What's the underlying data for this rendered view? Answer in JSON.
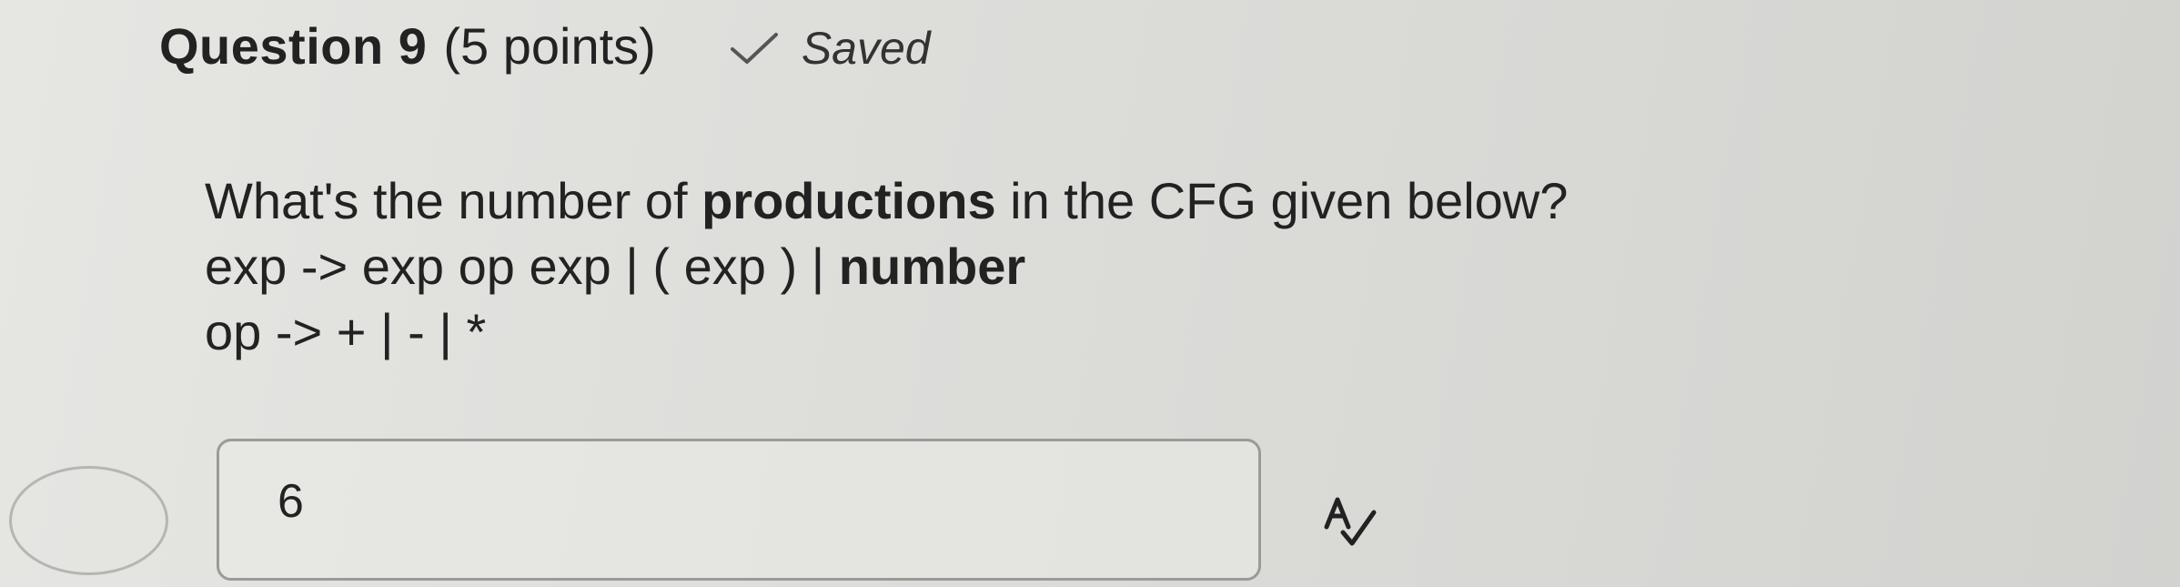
{
  "question": {
    "title": "Question 9",
    "points": "(5 points)",
    "saved_label": "Saved",
    "prompt_before": "What's the number of ",
    "prompt_bold": "productions",
    "prompt_after": " in the CFG given below?",
    "line_exp_before": "exp -> exp op exp | ( exp ) | ",
    "line_exp_bold": "number",
    "line_op": "op -> + | - | *"
  },
  "answer": {
    "value": "6"
  },
  "icons": {
    "saved_status": "check-icon",
    "spell_check": "spell-check-icon"
  },
  "colors": {
    "text": "#222222",
    "box_border": "#9a9a97"
  }
}
